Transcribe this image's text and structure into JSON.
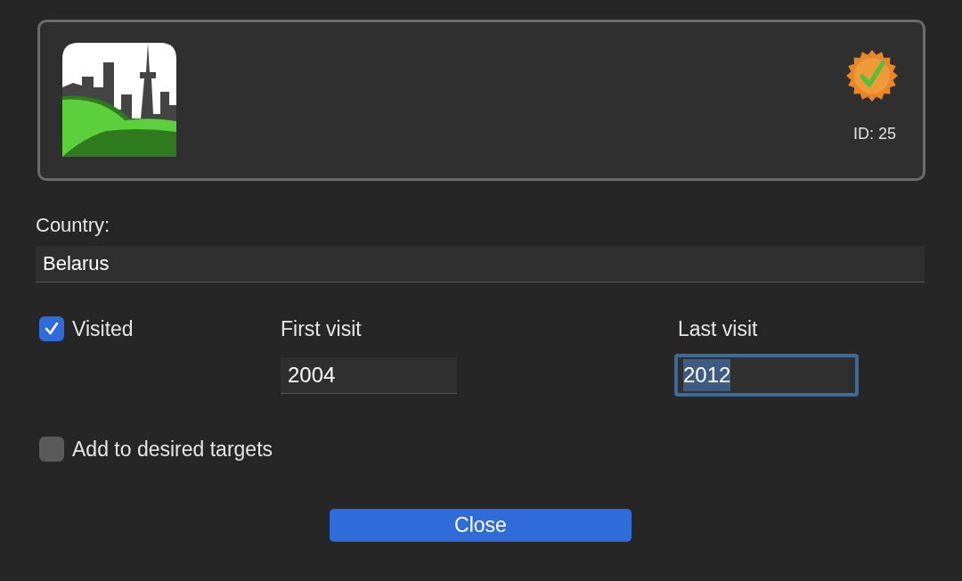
{
  "header": {
    "id_label": "ID: 25",
    "verified": true
  },
  "country": {
    "label": "Country:",
    "value": "Belarus"
  },
  "visited": {
    "label": "Visited",
    "checked": true
  },
  "visits": [
    {
      "label": "First visit",
      "value": "2004",
      "focused": false
    },
    {
      "label": "Last visit",
      "value": "2012",
      "focused": true
    }
  ],
  "desired": {
    "label": "Add to desired targets",
    "checked": false
  },
  "buttons": [
    {
      "label": "Close"
    }
  ]
}
